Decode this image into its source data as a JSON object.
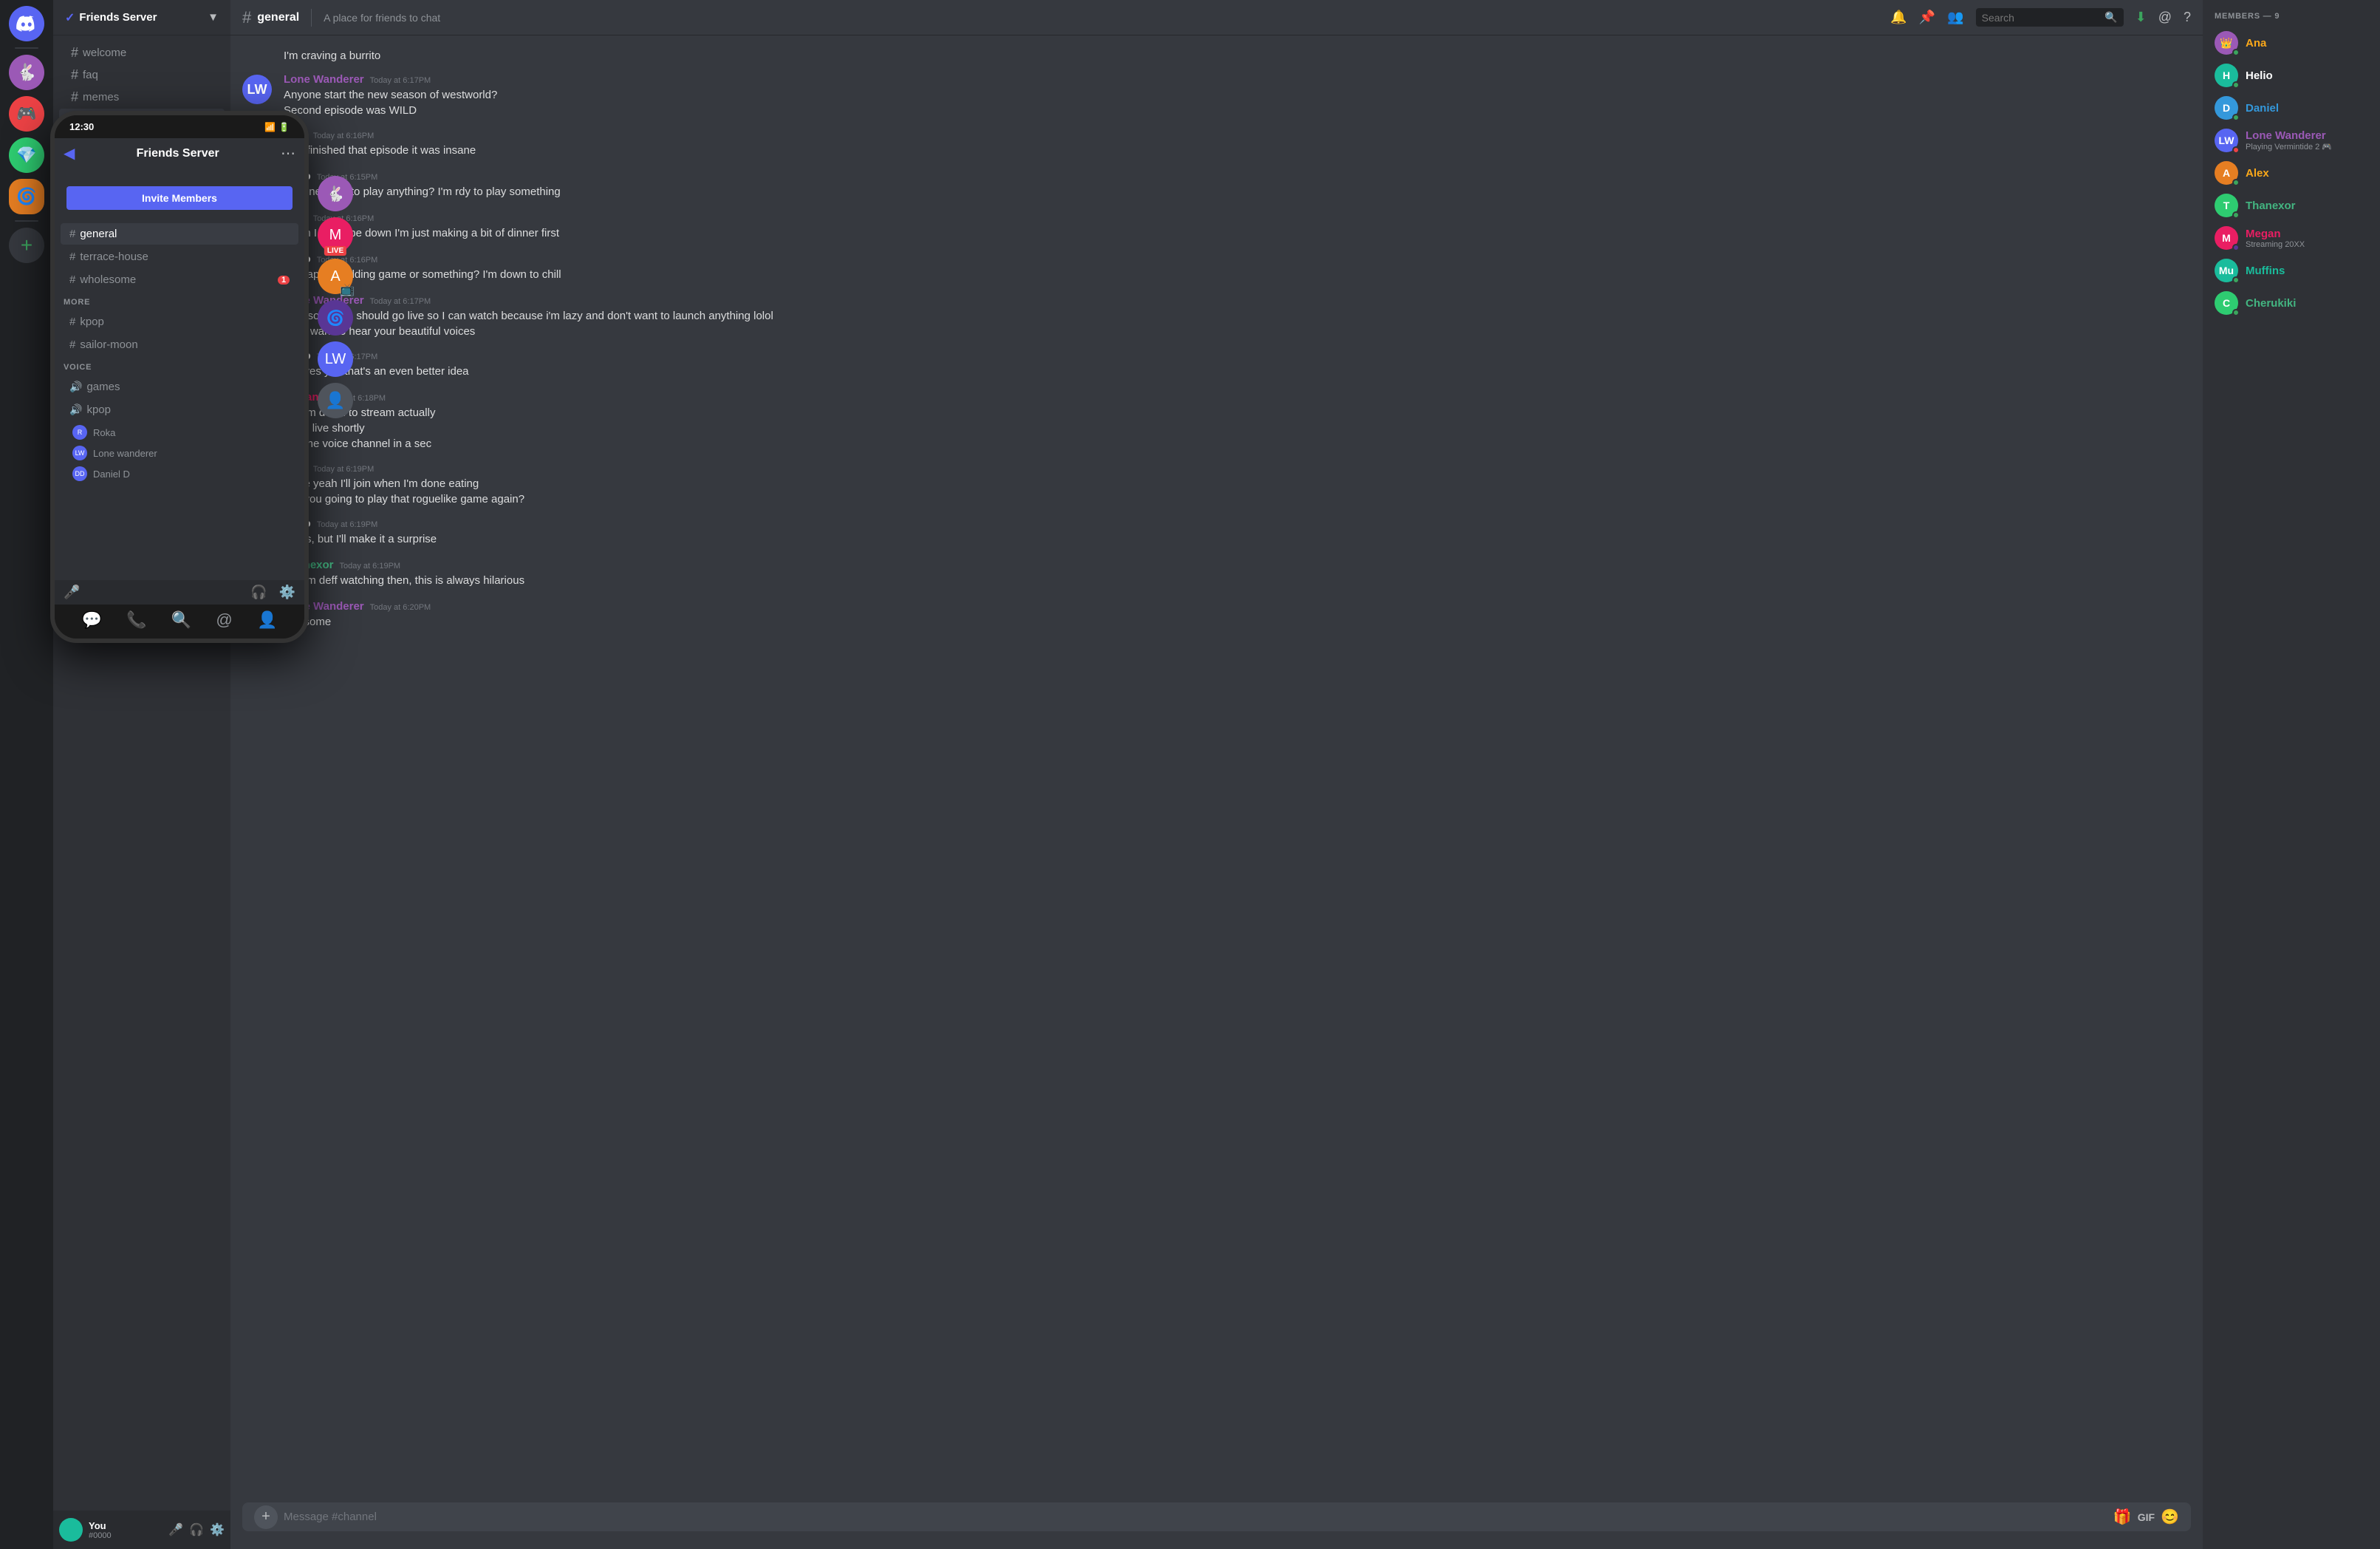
{
  "app": {
    "title": "DISCORD"
  },
  "desktop": {
    "server_name": "Friends Server",
    "verified": true,
    "channel": {
      "name": "general",
      "topic": "A place for friends to chat"
    },
    "search_placeholder": "Search",
    "members_header": "MEMBERS — 9",
    "members": [
      {
        "name": "Ana",
        "color": "color-name-yellow",
        "badge": "👑",
        "status": "online",
        "bg": "color-purple"
      },
      {
        "name": "Helio",
        "color": "color-name-white",
        "status": "online",
        "bg": "color-teal"
      },
      {
        "name": "Daniel",
        "color": "color-name-blue",
        "status": "online",
        "bg": "color-blue"
      },
      {
        "name": "Lone Wanderer",
        "color": "color-name-purple",
        "activity": "Playing Vermintide 2 🎮",
        "status": "dnd",
        "bg": "color-indigo"
      },
      {
        "name": "Alex",
        "color": "color-name-yellow",
        "status": "online",
        "bg": "color-orange"
      },
      {
        "name": "Thanexor",
        "color": "color-name-green",
        "status": "online",
        "bg": "color-green"
      },
      {
        "name": "Megan",
        "color": "color-name-pink",
        "activity": "Streaming 20XX",
        "status": "streaming",
        "bg": "color-pink"
      },
      {
        "name": "Muffins",
        "color": "color-name-cyan",
        "status": "online",
        "bg": "color-teal"
      },
      {
        "name": "Cherukiki",
        "color": "color-name-green",
        "status": "online",
        "bg": "color-green"
      }
    ],
    "channels": {
      "text": [
        {
          "name": "welcome",
          "active": false
        },
        {
          "name": "faq",
          "active": false
        },
        {
          "name": "memes",
          "active": false
        },
        {
          "name": "general",
          "active": true
        },
        {
          "name": "terrace-house",
          "active": false
        },
        {
          "name": "wholesome",
          "active": false,
          "badge": "1"
        }
      ],
      "more": [
        {
          "name": "kpop",
          "active": false
        },
        {
          "name": "sailor-moon",
          "active": false
        }
      ],
      "voice": [
        {
          "name": "games"
        },
        {
          "name": "kpop"
        }
      ],
      "voice_members": [
        {
          "name": "Roka",
          "bg": "color-blue"
        },
        {
          "name": "Lone wanderer",
          "bg": "color-indigo"
        },
        {
          "name": "Daniel D",
          "bg": "color-green"
        }
      ]
    },
    "messages": [
      {
        "id": "m1",
        "author": "Alex",
        "author_color": "color-name-yellow",
        "time": "",
        "avatar_bg": "color-orange",
        "avatar_text": "A",
        "lines": [
          "I'm craving a burrito"
        ],
        "continuation": true
      },
      {
        "id": "m2",
        "author": "Lone Wanderer",
        "author_color": "color-name-purple",
        "time": "Today at 6:17PM",
        "avatar_bg": "color-indigo",
        "avatar_text": "LW",
        "lines": [
          "Anyone start the new season of westworld?",
          "Second episode was WILD"
        ]
      },
      {
        "id": "m3",
        "author": "Alex",
        "author_color": "color-name-yellow",
        "time": "Today at 6:16PM",
        "avatar_bg": "color-orange",
        "avatar_text": "A",
        "lines": [
          "Just finished that episode it was insane"
        ]
      },
      {
        "id": "m4",
        "author": "Helio",
        "author_color": "color-name-white",
        "time": "Today at 6:15PM",
        "avatar_bg": "color-teal",
        "avatar_text": "H",
        "lines": [
          "Anyone want to play anything? I'm rdy to play something"
        ]
      },
      {
        "id": "m5",
        "author": "Alex",
        "author_color": "color-name-yellow",
        "time": "Today at 6:16PM",
        "avatar_bg": "color-orange",
        "avatar_text": "A",
        "lines": [
          "Ohhh I could be down I'm just making a bit of dinner first"
        ]
      },
      {
        "id": "m6",
        "author": "Helio",
        "author_color": "color-name-white",
        "time": "Today at 6:16PM",
        "avatar_bg": "color-teal",
        "avatar_text": "H",
        "lines": [
          "Perhaps a building game or something? I'm down to chill"
        ]
      },
      {
        "id": "m7",
        "author": "Lone Wanderer",
        "author_color": "color-name-purple",
        "time": "Today at 6:17PM",
        "avatar_bg": "color-indigo",
        "avatar_text": "LW",
        "lines": [
          "Ohh someone should go live so I can watch because i'm lazy and don't want to launch anything lolol",
          "I just want to hear your beautiful voices"
        ]
      },
      {
        "id": "m8",
        "author": "Helio",
        "author_color": "color-name-white",
        "time": "Today at 6:17PM",
        "avatar_bg": "color-teal",
        "avatar_text": "H",
        "lines": [
          "yes yes yes that's an even better idea"
        ]
      },
      {
        "id": "m9",
        "author": "Megan",
        "author_color": "color-name-pink",
        "time": "Today at 6:18PM",
        "avatar_bg": "color-pink",
        "avatar_text": "M",
        "lines": [
          "Oh I'm down to stream actually",
          "I'll go live shortly",
          "join the voice channel in a sec"
        ]
      },
      {
        "id": "m10",
        "author": "Alex",
        "author_color": "color-name-yellow",
        "time": "Today at 6:19PM",
        "avatar_bg": "color-orange",
        "avatar_text": "A",
        "lines": [
          "Dope yeah I'll join when I'm done eating",
          "Are you going to play that roguelike game again?"
        ]
      },
      {
        "id": "m11",
        "author": "Helio",
        "author_color": "color-name-white",
        "time": "Today at 6:19PM",
        "avatar_bg": "color-teal",
        "avatar_text": "H",
        "lines": [
          "probs, but I'll make it a surprise"
        ]
      },
      {
        "id": "m12",
        "author": "Thanexor",
        "author_color": "color-name-green",
        "time": "Today at 6:19PM",
        "avatar_bg": "color-green",
        "avatar_text": "T",
        "lines": [
          "Oh I'm deff watching then, this is always hilarious"
        ]
      },
      {
        "id": "m13",
        "author": "Lone Wanderer",
        "author_color": "color-name-purple",
        "time": "Today at 6:20PM",
        "avatar_bg": "color-indigo",
        "avatar_text": "LW",
        "lines": [
          "awesome"
        ]
      }
    ],
    "message_placeholder": "Message #channel",
    "invite_button": "Invite Members"
  },
  "phone": {
    "time": "12:30",
    "server_name": "Friends Server",
    "channels": [
      {
        "name": "general",
        "active": true
      },
      {
        "name": "terrace-house",
        "active": false
      },
      {
        "name": "wholesome",
        "active": false,
        "badge": "1"
      }
    ],
    "more_label": "MORE",
    "more_channels": [
      {
        "name": "kpop"
      },
      {
        "name": "sailor-moon"
      }
    ],
    "voice_label": "VOICE",
    "voice_channels": [
      {
        "name": "games"
      },
      {
        "name": "kpop"
      }
    ],
    "voice_members": [
      {
        "name": "Roka"
      },
      {
        "name": "Lone wanderer"
      },
      {
        "name": "Daniel D"
      }
    ],
    "invite_button": "Invite Members"
  }
}
